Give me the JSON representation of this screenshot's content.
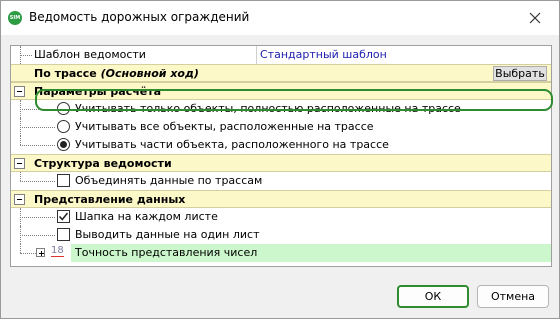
{
  "window": {
    "title": "Ведомость дорожных ограждений",
    "app_icon_text": "SIM"
  },
  "grid": {
    "template_row": {
      "label": "Шаблон ведомости",
      "value": "Стандартный шаблон"
    },
    "route_row": {
      "label": "По трассе",
      "label_italic": "(Основной ход)",
      "button": "Выбрать"
    },
    "calc_section": {
      "label": "Параметры расчёта",
      "options": [
        {
          "label": "Учитывать только объекты, полностью расположенные на трассе",
          "checked": false
        },
        {
          "label": "Учитывать все объекты, расположенные на трассе",
          "checked": false
        },
        {
          "label": "Учитывать части объекта, расположенного на трассе",
          "checked": true
        }
      ]
    },
    "structure_section": {
      "label": "Структура ведомости",
      "items": [
        {
          "label": "Объединять данные по трассам",
          "checked": false
        }
      ]
    },
    "presentation_section": {
      "label": "Представление данных",
      "items": [
        {
          "label": "Шапка на каждом листе",
          "checked": true
        },
        {
          "label": "Выводить данные на один лист",
          "checked": false
        }
      ],
      "precision": {
        "label": "Точность представления чисел",
        "icon_text": "18"
      }
    }
  },
  "buttons": {
    "ok": "ОК",
    "cancel": "Отмена"
  },
  "colors": {
    "section_bg": "#fdf8c8",
    "highlight": "#2e8b2e",
    "precision_row_bg": "#ccf7cc",
    "value_text": "#2020b0"
  }
}
